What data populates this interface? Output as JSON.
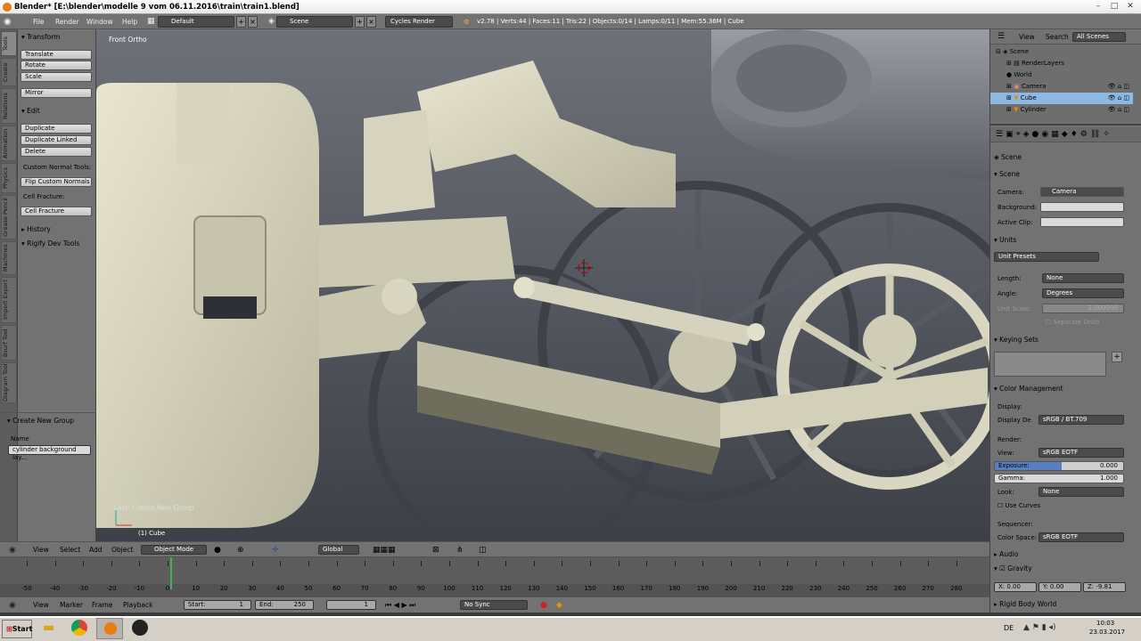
{
  "window": {
    "title": "Blender* [E:\\blender\\modelle 9 vom 06.11.2016\\train\\train1.blend]",
    "minimize": "–",
    "maximize": "□",
    "close": "✕"
  },
  "topbar": {
    "menu": [
      "File",
      "Render",
      "Window",
      "Help"
    ],
    "layout": "Default",
    "scene": "Scene",
    "engine": "Cycles Render",
    "stats": "v2.78 | Verts:44 | Faces:11 | Tris:22 | Objects:0/14 | Lamps:0/11 | Mem:55.36M | Cube"
  },
  "toolstrip": {
    "tabs": [
      "Tools",
      "Create",
      "Relations",
      "Animation",
      "Physics",
      "Grease Pencil",
      "Machines",
      "Import Export",
      "Bsurf Tool",
      "Diagram Tool"
    ]
  },
  "toolshelf": {
    "transform_header": "Transform",
    "transform_buttons": [
      "Translate",
      "Rotate",
      "Scale"
    ],
    "mirror": "Mirror",
    "edit_header": "Edit",
    "edit_buttons": [
      "Duplicate",
      "Duplicate Linked",
      "Delete"
    ],
    "custom_normal_label": "Custom Normal Tools:",
    "flip_normals": "Flip Custom Normals",
    "cell_fracture_label": "Cell Fracture:",
    "cell_fracture": "Cell Fracture",
    "history_header": "History",
    "rigify_header": "Rigify Dev Tools",
    "create_group_header": "Create New Group",
    "name_label": "Name",
    "name_value": "cylinder background lay..."
  },
  "viewport": {
    "view_label": "Front Ortho",
    "last_op": "Last: Create New Group",
    "object_label": "(1) Cube"
  },
  "vpheader": {
    "menu": [
      "View",
      "Select",
      "Add",
      "Object"
    ],
    "mode": "Object Mode",
    "orientation": "Global"
  },
  "timeline": {
    "ticks": [
      "-50",
      "-40",
      "-30",
      "-20",
      "-10",
      "0",
      "10",
      "20",
      "30",
      "40",
      "50",
      "60",
      "70",
      "80",
      "90",
      "100",
      "110",
      "120",
      "130",
      "140",
      "150",
      "160",
      "170",
      "180",
      "190",
      "200",
      "210",
      "220",
      "230",
      "240",
      "250",
      "260",
      "270",
      "280"
    ],
    "current_frame": 1,
    "menu": [
      "View",
      "Marker",
      "Frame",
      "Playback"
    ],
    "start_label": "Start:",
    "start_value": "1",
    "end_label": "End:",
    "end_value": "250",
    "frame_value": "1",
    "sync": "No Sync"
  },
  "outliner": {
    "menu": [
      "View",
      "Search"
    ],
    "filter": "All Scenes",
    "items": [
      "Scene",
      "RenderLayers",
      "World",
      "Camera",
      "Cube",
      "Cylinder"
    ]
  },
  "properties": {
    "context": "Scene",
    "scene_header": "Scene",
    "camera_label": "Camera:",
    "camera_value": "Camera",
    "background_label": "Background:",
    "active_clip_label": "Active Clip:",
    "units_header": "Units",
    "unit_presets": "Unit Presets",
    "length_label": "Length:",
    "length_value": "None",
    "angle_label": "Angle:",
    "angle_value": "Degrees",
    "unit_scale_label": "Unit Scale:",
    "unit_scale_value": "1.000000",
    "separate_units": "Separate Units",
    "keying_header": "Keying Sets",
    "color_header": "Color Management",
    "display_label": "Display:",
    "display_device_label": "Display De",
    "display_device_value": "sRGB / BT.709",
    "render_label": "Render:",
    "view_label": "View:",
    "view_value": "sRGB EOTF",
    "exposure_label": "Exposure:",
    "exposure_value": "0.000",
    "gamma_label": "Gamma:",
    "gamma_value": "1.000",
    "look_label": "Look:",
    "look_value": "None",
    "use_curves": "Use Curves",
    "sequencer_label": "Sequencer:",
    "color_space_label": "Color Space:",
    "color_space_value": "sRGB EOTF",
    "audio_header": "Audio",
    "gravity_header": "Gravity",
    "gx": "X: 0.00",
    "gy": "Y: 0.00",
    "gz": "Z: -9.81",
    "rigid_header": "Rigid Body World"
  },
  "taskbar": {
    "start": "Start",
    "lang": "DE",
    "time": "10:03",
    "date": "23.03.2017"
  }
}
